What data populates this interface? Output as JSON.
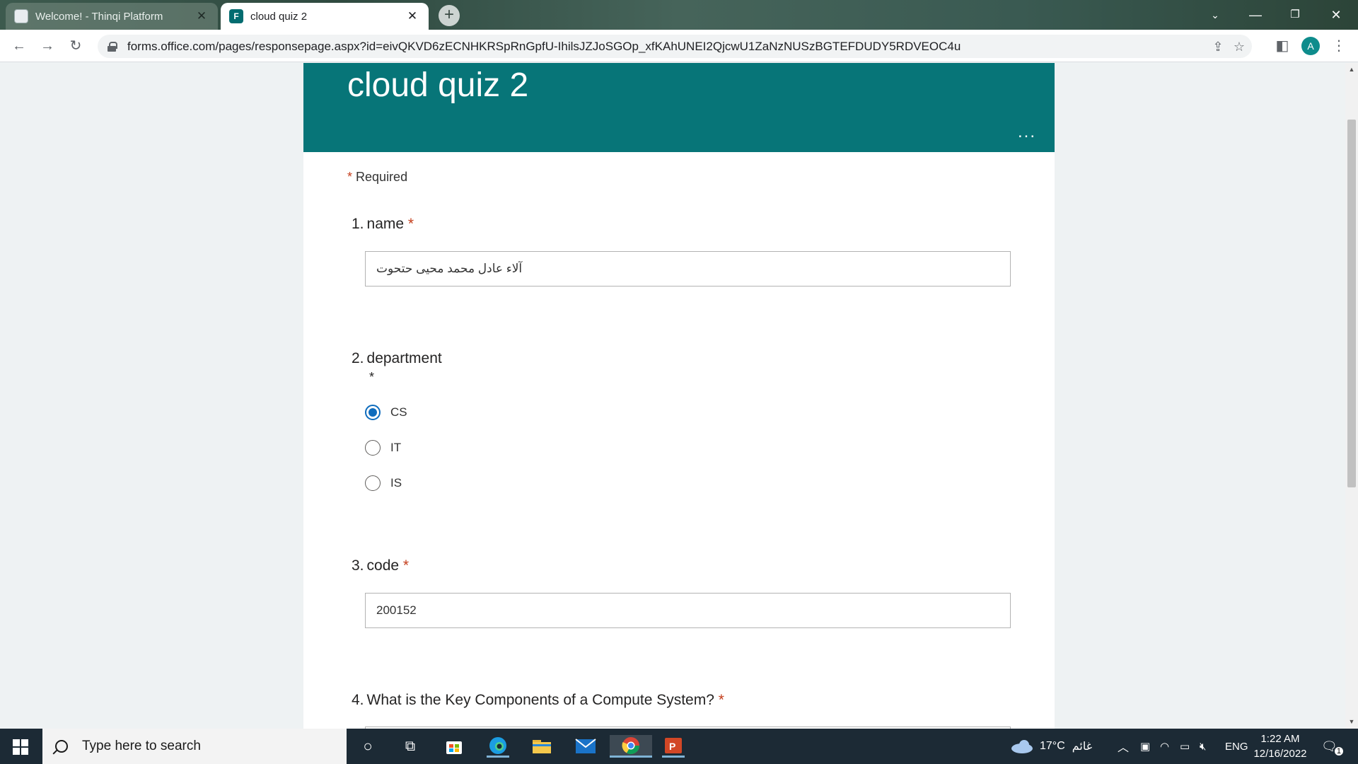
{
  "browser": {
    "tabs": [
      {
        "title": "Welcome! - Thinqi Platform"
      },
      {
        "title": "cloud quiz 2"
      }
    ],
    "url": "forms.office.com/pages/responsepage.aspx?id=eivQKVD6zECNHKRSpRnGpfU-IhilsJZJoSGOp_xfKAhUNEI2QjcwU1ZaNzNUSzBGTEFDUDY5RDVEOC4u",
    "profile_initial": "A"
  },
  "form": {
    "title": "cloud quiz 2",
    "required_label": "Required",
    "required_marker": "*",
    "questions": [
      {
        "number": "1.",
        "label": "name",
        "answer": "آلاء عادل محمد محيى حتحوت"
      },
      {
        "number": "2.",
        "label": "department",
        "options": [
          "CS",
          "IT",
          "IS"
        ],
        "selected": "CS"
      },
      {
        "number": "3.",
        "label": "code",
        "answer": "200152"
      },
      {
        "number": "4.",
        "label": "What is the Key Components of a Compute System?"
      }
    ]
  },
  "taskbar": {
    "search_placeholder": "Type here to search",
    "weather": "17°C",
    "weather_text": "غائم",
    "language": "ENG",
    "time": "1:22 AM",
    "date": "12/16/2022",
    "notification_count": "1"
  },
  "colors": {
    "form_header": "#077578",
    "required_star": "#c43e1c",
    "radio_selected": "#0f6cbd"
  }
}
